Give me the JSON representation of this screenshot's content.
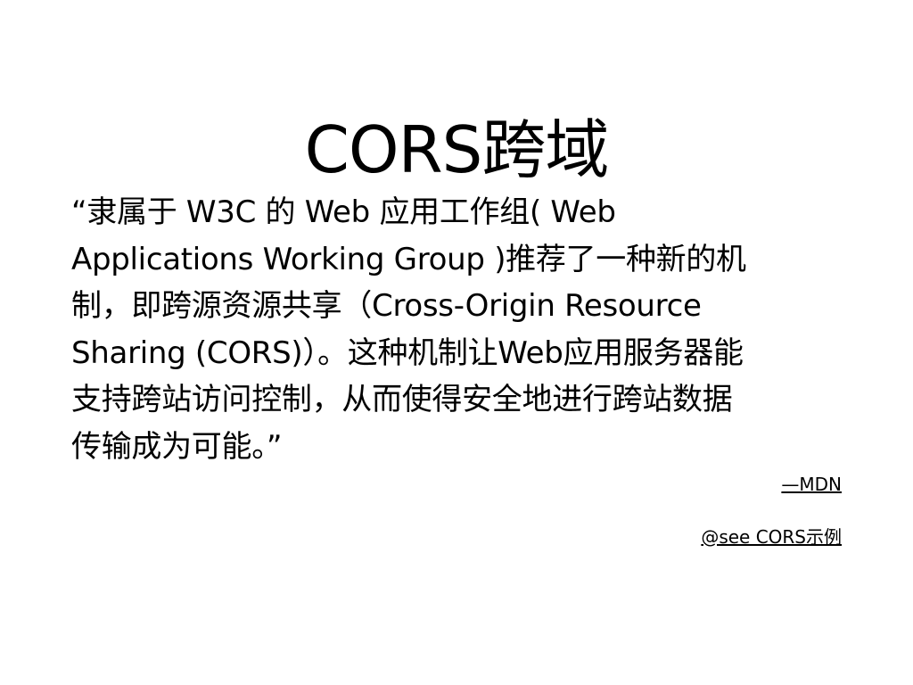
{
  "slide": {
    "title": "CORS跨域",
    "quote_lines": [
      "“隶属于 W3C 的 Web 应用工作组( Web",
      "Applications Working Group )推荐了一种新的机",
      "制，即跨源资源共享（Cross-Origin Resource",
      "Sharing (CORS)）。这种机制让Web应用服务器能",
      "支持跨站访问控制，从而使得安全地进行跨站数据",
      "传输成为可能。”"
    ],
    "attribution": "—MDN",
    "see_link": "@see CORS示例"
  }
}
